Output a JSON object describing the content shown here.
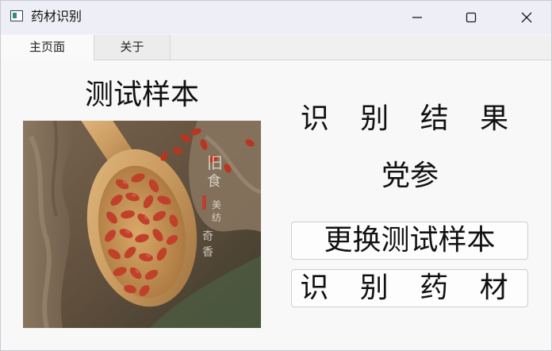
{
  "window": {
    "title": "药材识别"
  },
  "tabs": [
    {
      "label": "主页面",
      "active": true
    },
    {
      "label": "关于",
      "active": false
    }
  ],
  "main": {
    "sample_title": "测试样本",
    "result_title": "识 别 结 果",
    "result_value": "党参",
    "change_sample_button": "更换测试样本",
    "identify_button": "识 别 药 材"
  },
  "image_overlay": {
    "vertical_text": "旧食 美 纺 奇香"
  },
  "colors": {
    "title_bar": "#eeeff6",
    "content_bg": "#f8f8f8",
    "tab_active": "#fafafa",
    "tab_inactive": "#ececec"
  },
  "icons": {
    "app": "app-icon",
    "minimize": "minimize-icon",
    "maximize": "maximize-icon",
    "close": "close-icon"
  }
}
